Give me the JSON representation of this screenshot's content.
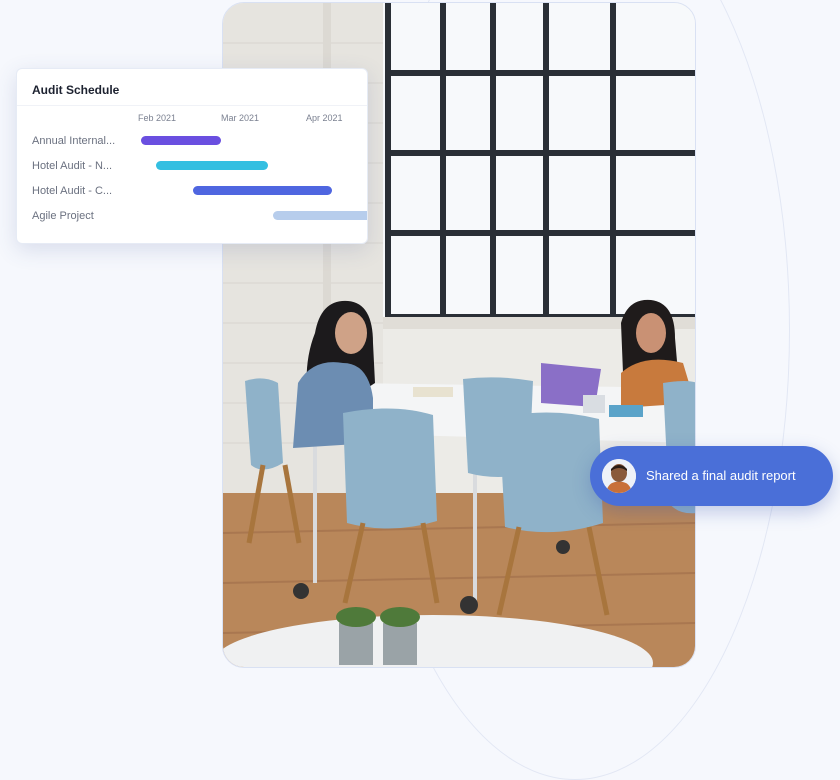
{
  "gantt": {
    "title": "Audit Schedule",
    "months": [
      "Feb 2021",
      "Mar 2021",
      "Apr 2021"
    ],
    "rows": [
      {
        "label": "Annual Internal...",
        "color": "#6a4fe0"
      },
      {
        "label": "Hotel Audit - N...",
        "color": "#34bfe1"
      },
      {
        "label": "Hotel Audit - C...",
        "color": "#4f66e0"
      },
      {
        "label": "Agile Project",
        "color": "#b7cdec"
      }
    ]
  },
  "notification": {
    "text": "Shared a final audit report",
    "accent": "#4a6fd8"
  }
}
